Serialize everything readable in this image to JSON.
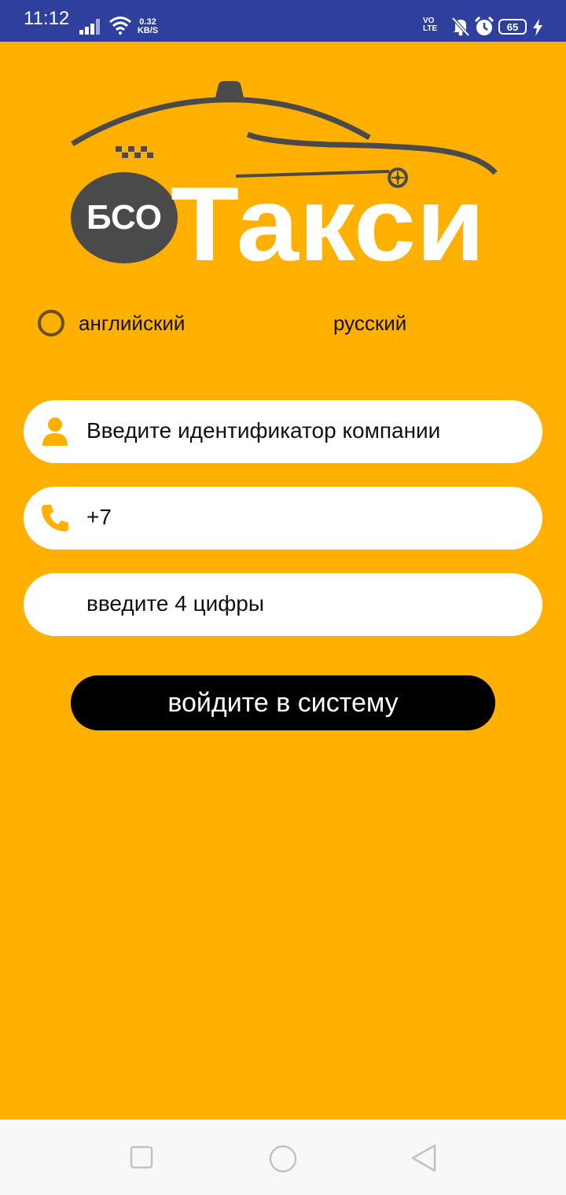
{
  "status_bar": {
    "time": "11:12",
    "net_speed_value": "0.32",
    "net_speed_unit": "KB/S",
    "volte_line1": "VO",
    "volte_line2": "LTE",
    "battery_level": "65",
    "icons": [
      "signal-icon",
      "wifi-icon",
      "mute-icon",
      "alarm-icon",
      "battery-icon",
      "bolt-icon"
    ]
  },
  "logo": {
    "badge_text": "БСО",
    "brand_text": "Такси"
  },
  "language": {
    "option_en": "английский",
    "option_ru": "русский"
  },
  "form": {
    "company_id_placeholder": "Введите идентификатор компании",
    "phone_value": "+7",
    "code_placeholder": "введите 4 цифры",
    "login_label": "войдите в систему"
  },
  "colors": {
    "background": "#FFB000",
    "status_bar": "#2F3F9E",
    "button": "#000000",
    "logo_gray": "#4A4A4A"
  }
}
